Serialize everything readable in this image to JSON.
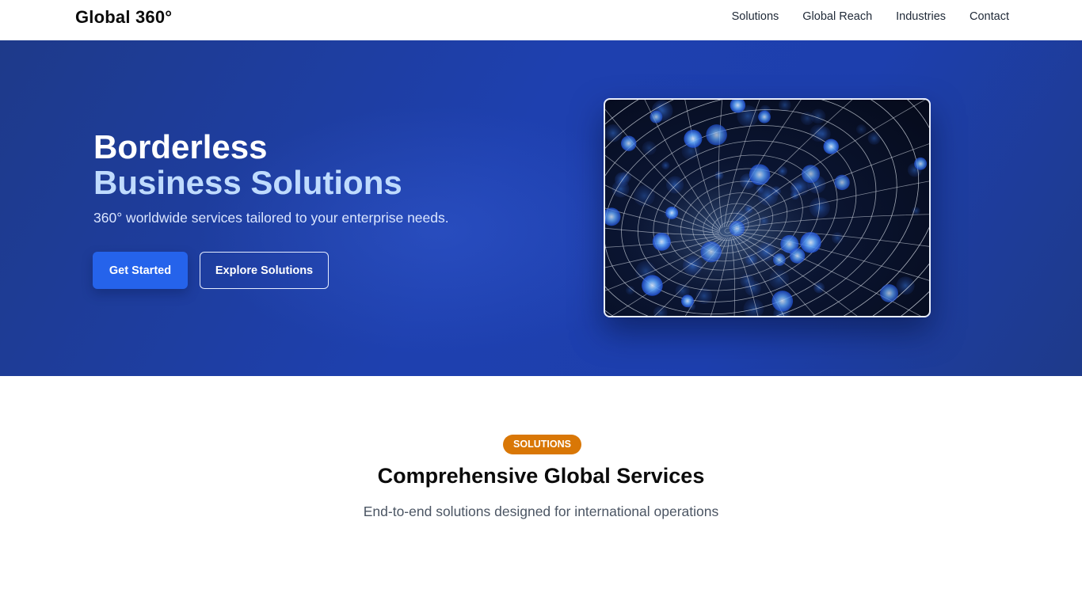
{
  "header": {
    "logo": "Global 360°",
    "nav": [
      "Solutions",
      "Global Reach",
      "Industries",
      "Contact"
    ]
  },
  "hero": {
    "title_line1": "Borderless",
    "title_line2": "Business Solutions",
    "subtitle": "360° worldwide services tailored to your enterprise needs.",
    "primary_button": "Get Started",
    "secondary_button": "Explore Solutions"
  },
  "section": {
    "badge": "SOLUTIONS",
    "title": "Comprehensive Global Services",
    "subtitle": "End-to-end solutions designed for international operations"
  },
  "colors": {
    "hero_bg": "#1e40af",
    "primary": "#2563eb",
    "badge": "#d97706",
    "title_accent": "#bfdbfe"
  }
}
